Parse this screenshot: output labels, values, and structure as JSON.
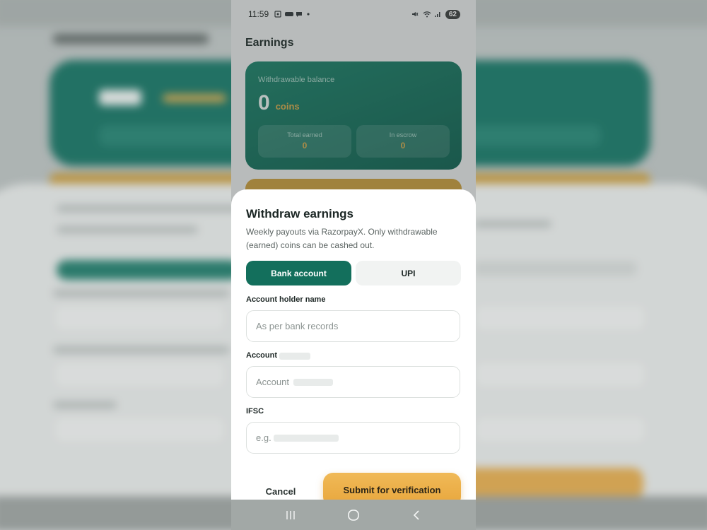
{
  "status_bar": {
    "time": "11:59",
    "battery": "62",
    "icons": [
      "screenshot-icon",
      "notification-icon",
      "chat-icon",
      "dot-icon",
      "mute-icon",
      "wifi-icon",
      "signal-icon"
    ]
  },
  "page": {
    "title": "Earnings"
  },
  "balance_card": {
    "label": "Withdrawable balance",
    "value": "0",
    "unit": "coins",
    "stats": [
      {
        "label": "Total earned",
        "value": "0"
      },
      {
        "label": "In escrow",
        "value": "0"
      }
    ]
  },
  "withdraw_sheet": {
    "title": "Withdraw earnings",
    "subtitle": "Weekly payouts via RazorpayX. Only withdrawable (earned) coins can be cashed out.",
    "tabs": [
      {
        "label": "Bank account",
        "active": true
      },
      {
        "label": "UPI",
        "active": false
      }
    ],
    "fields": [
      {
        "label": "Account holder name",
        "placeholder": "As per bank records"
      },
      {
        "label": "Account",
        "placeholder": "Account"
      },
      {
        "label": "IFSC",
        "placeholder": "e.g."
      }
    ],
    "cancel_label": "Cancel",
    "submit_label": "Submit for verification"
  },
  "nav_bar": {
    "icons": [
      "recents-icon",
      "home-icon",
      "back-icon"
    ]
  },
  "colors": {
    "primary": "#136f5c",
    "accent": "#e8a63c",
    "card_gradient_start": "#1a8068",
    "card_gradient_end": "#0e6150"
  }
}
